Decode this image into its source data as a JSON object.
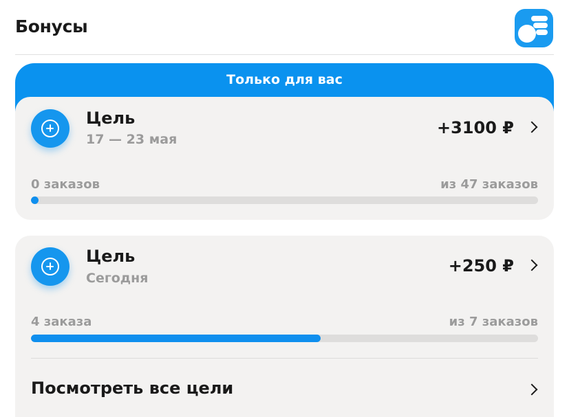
{
  "header": {
    "title": "Бонусы",
    "icon": "bonus-coins-icon"
  },
  "banner": {
    "text": "Только для вас",
    "color": "#0a92ef"
  },
  "goals": [
    {
      "title": "Цель",
      "subtitle": "17 — 23 мая",
      "amount": "+3100 ₽",
      "progress_label": "0 заказов",
      "target_label": "из 47 заказов",
      "progress_fraction": 0.0
    },
    {
      "title": "Цель",
      "subtitle": "Сегодня",
      "amount": "+250 ₽",
      "progress_label": "4 заказа",
      "target_label": "из 7 заказов",
      "progress_fraction": 0.5714
    }
  ],
  "all_goals_label": "Посмотреть все цели",
  "colors": {
    "accent": "#1596ee",
    "card_bg": "#f3f2f1",
    "track": "#dedddc",
    "muted_text": "#9b9b9b"
  }
}
